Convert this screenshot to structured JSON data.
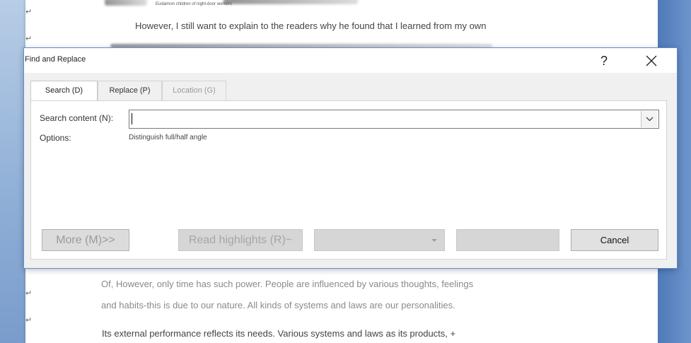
{
  "document": {
    "line_top_caption": "Eudaimon children of night-door workers",
    "line_1": "However, I still want to explain to the readers why he found that I learned from my own",
    "line_2": "Of, However, only time has such power. People are influenced by various thoughts, feelings",
    "line_3": "and habits-this is due to our nature. All kinds of systems and laws are our personalities.",
    "line_4": "Its external performance reflects its needs. Various systems and laws as its products, +",
    "para_mark": "↵"
  },
  "dialog": {
    "title": "Find and Replace",
    "help_label": "?",
    "tabs": [
      {
        "label": "Search (D)"
      },
      {
        "label": "Replace (P)"
      },
      {
        "label": "Location (G)"
      }
    ],
    "search": {
      "label": "Search content (N):",
      "value": ""
    },
    "options": {
      "label": "Options:",
      "value": "Distinguish full/half angle"
    },
    "buttons": {
      "more": "More (M)>>",
      "read_highlights": "Read highlights (R)~",
      "find_in": "",
      "find_next": "",
      "cancel": "Cancel"
    }
  },
  "colors": {
    "dialog_border": "#5b8fd1",
    "button_face": "#e1e1e1",
    "disabled_text": "#9a9a9a"
  }
}
